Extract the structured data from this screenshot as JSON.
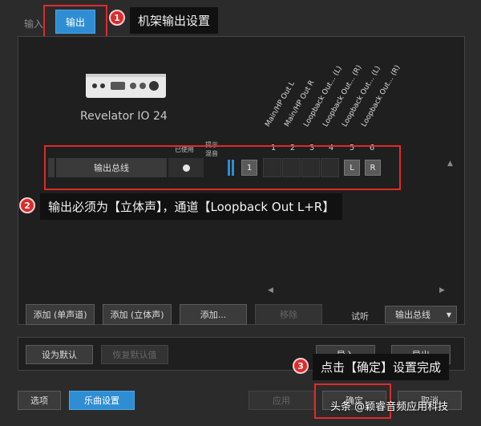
{
  "tabs": {
    "input": "输入",
    "output": "输出"
  },
  "callouts": [
    {
      "num": "1",
      "text": "机架输出设置"
    },
    {
      "num": "2",
      "text": "输出必须为【立体声】，通道【Loopback Out L+R】"
    },
    {
      "num": "3",
      "text": "点击【确定】设置完成"
    }
  ],
  "device": {
    "name": "Revelator IO 24"
  },
  "columns": [
    "Main/HP Out L",
    "Main/HP Out R",
    "Loopback Out... (L)",
    "Loopback Out... (R)",
    "Loopback Out... (L)",
    "Loopback Out... (R)"
  ],
  "column_numbers": [
    "1",
    "2",
    "3",
    "4",
    "5",
    "6"
  ],
  "labels": {
    "used": "已使用",
    "hint_line1": "提示",
    "hint_line2": "混音"
  },
  "bus_row": {
    "name": "输出总线",
    "index": "1",
    "left": "L",
    "right": "R"
  },
  "scroll": {
    "up": "▲",
    "left": "◀",
    "right": "▶"
  },
  "buttons": {
    "add_mono": "添加 (单声道)",
    "add_stereo": "添加 (立体声)",
    "add_more": "添加...",
    "remove": "移除",
    "audition": "试听",
    "audition_select": "输出总线",
    "set_default": "设为默认",
    "restore_default": "恢复默认值",
    "import": "导入",
    "export": "导出",
    "options": "选项",
    "song_settings": "乐曲设置",
    "apply": "应用",
    "ok": "确定",
    "cancel": "取消"
  },
  "watermark": "头条 @颖睿音频应用科技",
  "colors": {
    "accent": "#2f8ed3",
    "highlight": "#e02a2a",
    "background": "#2b2b2b",
    "panel": "#1f1f1f"
  }
}
